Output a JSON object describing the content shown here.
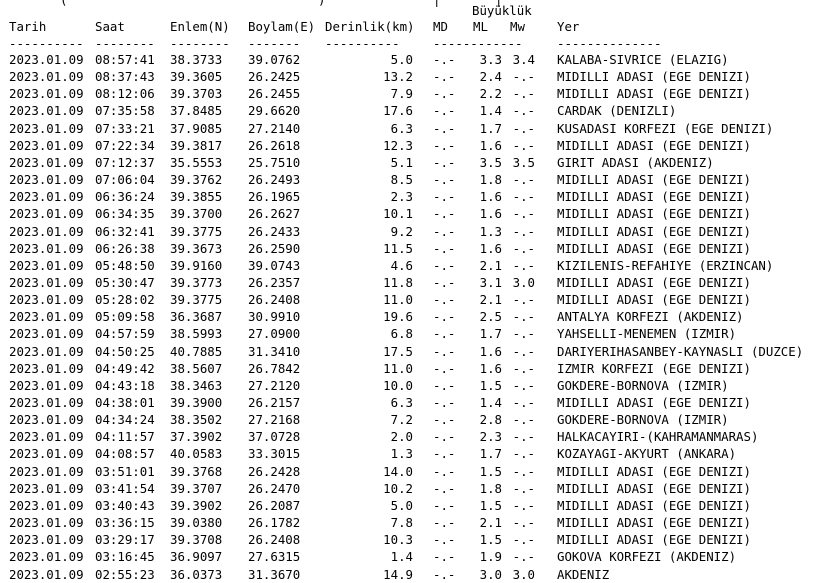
{
  "partial_top": {
    "left": "(",
    "mid": ")",
    "right": "|"
  },
  "magnitude_title": "Büyüklük",
  "headers": {
    "date": "Tarih",
    "time": "Saat",
    "lat": "Enlem(N)",
    "lon": "Boylam(E)",
    "depth": "Derinlik(km)",
    "md": "MD",
    "ml": "ML",
    "mw": "Mw",
    "location": "Yer"
  },
  "dashes": {
    "date": "----------",
    "time": "--------",
    "lat": "--------",
    "lon": "-------",
    "depth": "----------",
    "mag": "------------",
    "location": "--------------"
  },
  "rows": [
    {
      "date": "2023.01.09",
      "time": "08:57:41",
      "lat": "38.3733",
      "lon": "39.0762",
      "depth": "5.0",
      "md": "-.-",
      "ml": "3.3",
      "mw": "3.4",
      "location": "KALABA-SIVRICE (ELAZIG)"
    },
    {
      "date": "2023.01.09",
      "time": "08:37:43",
      "lat": "39.3605",
      "lon": "26.2425",
      "depth": "13.2",
      "md": "-.-",
      "ml": "2.4",
      "mw": "-.-",
      "location": "MIDILLI ADASI (EGE DENIZI)"
    },
    {
      "date": "2023.01.09",
      "time": "08:12:06",
      "lat": "39.3703",
      "lon": "26.2455",
      "depth": "7.9",
      "md": "-.-",
      "ml": "2.2",
      "mw": "-.-",
      "location": "MIDILLI ADASI (EGE DENIZI)"
    },
    {
      "date": "2023.01.09",
      "time": "07:35:58",
      "lat": "37.8485",
      "lon": "29.6620",
      "depth": "17.6",
      "md": "-.-",
      "ml": "1.4",
      "mw": "-.-",
      "location": "CARDAK (DENIZLI)"
    },
    {
      "date": "2023.01.09",
      "time": "07:33:21",
      "lat": "37.9085",
      "lon": "27.2140",
      "depth": "6.3",
      "md": "-.-",
      "ml": "1.7",
      "mw": "-.-",
      "location": "KUSADASI KORFEZI (EGE DENIZI)"
    },
    {
      "date": "2023.01.09",
      "time": "07:22:34",
      "lat": "39.3817",
      "lon": "26.2618",
      "depth": "12.3",
      "md": "-.-",
      "ml": "1.6",
      "mw": "-.-",
      "location": "MIDILLI ADASI (EGE DENIZI)"
    },
    {
      "date": "2023.01.09",
      "time": "07:12:37",
      "lat": "35.5553",
      "lon": "25.7510",
      "depth": "5.1",
      "md": "-.-",
      "ml": "3.5",
      "mw": "3.5",
      "location": "GIRIT ADASI (AKDENIZ)"
    },
    {
      "date": "2023.01.09",
      "time": "07:06:04",
      "lat": "39.3762",
      "lon": "26.2493",
      "depth": "8.5",
      "md": "-.-",
      "ml": "1.8",
      "mw": "-.-",
      "location": "MIDILLI ADASI (EGE DENIZI)"
    },
    {
      "date": "2023.01.09",
      "time": "06:36:24",
      "lat": "39.3855",
      "lon": "26.1965",
      "depth": "2.3",
      "md": "-.-",
      "ml": "1.6",
      "mw": "-.-",
      "location": "MIDILLI ADASI (EGE DENIZI)"
    },
    {
      "date": "2023.01.09",
      "time": "06:34:35",
      "lat": "39.3700",
      "lon": "26.2627",
      "depth": "10.1",
      "md": "-.-",
      "ml": "1.6",
      "mw": "-.-",
      "location": "MIDILLI ADASI (EGE DENIZI)"
    },
    {
      "date": "2023.01.09",
      "time": "06:32:41",
      "lat": "39.3775",
      "lon": "26.2433",
      "depth": "9.2",
      "md": "-.-",
      "ml": "1.3",
      "mw": "-.-",
      "location": "MIDILLI ADASI (EGE DENIZI)"
    },
    {
      "date": "2023.01.09",
      "time": "06:26:38",
      "lat": "39.3673",
      "lon": "26.2590",
      "depth": "11.5",
      "md": "-.-",
      "ml": "1.6",
      "mw": "-.-",
      "location": "MIDILLI ADASI (EGE DENIZI)"
    },
    {
      "date": "2023.01.09",
      "time": "05:48:50",
      "lat": "39.9160",
      "lon": "39.0743",
      "depth": "4.6",
      "md": "-.-",
      "ml": "2.1",
      "mw": "-.-",
      "location": "KIZILENIS-REFAHIYE (ERZINCAN)"
    },
    {
      "date": "2023.01.09",
      "time": "05:30:47",
      "lat": "39.3773",
      "lon": "26.2357",
      "depth": "11.8",
      "md": "-.-",
      "ml": "3.1",
      "mw": "3.0",
      "location": "MIDILLI ADASI (EGE DENIZI)"
    },
    {
      "date": "2023.01.09",
      "time": "05:28:02",
      "lat": "39.3775",
      "lon": "26.2408",
      "depth": "11.0",
      "md": "-.-",
      "ml": "2.1",
      "mw": "-.-",
      "location": "MIDILLI ADASI (EGE DENIZI)"
    },
    {
      "date": "2023.01.09",
      "time": "05:09:58",
      "lat": "36.3687",
      "lon": "30.9910",
      "depth": "19.6",
      "md": "-.-",
      "ml": "2.5",
      "mw": "-.-",
      "location": "ANTALYA KORFEZI (AKDENIZ)"
    },
    {
      "date": "2023.01.09",
      "time": "04:57:59",
      "lat": "38.5993",
      "lon": "27.0900",
      "depth": "6.8",
      "md": "-.-",
      "ml": "1.7",
      "mw": "-.-",
      "location": "YAHSELLI-MENEMEN (IZMIR)"
    },
    {
      "date": "2023.01.09",
      "time": "04:50:25",
      "lat": "40.7885",
      "lon": "31.3410",
      "depth": "17.5",
      "md": "-.-",
      "ml": "1.6",
      "mw": "-.-",
      "location": "DARIYERIHASANBEY-KAYNASLI (DUZCE)"
    },
    {
      "date": "2023.01.09",
      "time": "04:49:42",
      "lat": "38.5607",
      "lon": "26.7842",
      "depth": "11.0",
      "md": "-.-",
      "ml": "1.6",
      "mw": "-.-",
      "location": "IZMIR KORFEZI (EGE DENIZI)"
    },
    {
      "date": "2023.01.09",
      "time": "04:43:18",
      "lat": "38.3463",
      "lon": "27.2120",
      "depth": "10.0",
      "md": "-.-",
      "ml": "1.5",
      "mw": "-.-",
      "location": "GOKDERE-BORNOVA (IZMIR)"
    },
    {
      "date": "2023.01.09",
      "time": "04:38:01",
      "lat": "39.3900",
      "lon": "26.2157",
      "depth": "6.3",
      "md": "-.-",
      "ml": "1.4",
      "mw": "-.-",
      "location": "MIDILLI ADASI (EGE DENIZI)"
    },
    {
      "date": "2023.01.09",
      "time": "04:34:24",
      "lat": "38.3502",
      "lon": "27.2168",
      "depth": "7.2",
      "md": "-.-",
      "ml": "2.8",
      "mw": "-.-",
      "location": "GOKDERE-BORNOVA (IZMIR)"
    },
    {
      "date": "2023.01.09",
      "time": "04:11:57",
      "lat": "37.3902",
      "lon": "37.0728",
      "depth": "2.0",
      "md": "-.-",
      "ml": "2.3",
      "mw": "-.-",
      "location": "HALKACAYIRI-(KAHRAMANMARAS)"
    },
    {
      "date": "2023.01.09",
      "time": "04:08:57",
      "lat": "40.0583",
      "lon": "33.3015",
      "depth": "1.3",
      "md": "-.-",
      "ml": "1.7",
      "mw": "-.-",
      "location": "KOZAYAGI-AKYURT (ANKARA)"
    },
    {
      "date": "2023.01.09",
      "time": "03:51:01",
      "lat": "39.3768",
      "lon": "26.2428",
      "depth": "14.0",
      "md": "-.-",
      "ml": "1.5",
      "mw": "-.-",
      "location": "MIDILLI ADASI (EGE DENIZI)"
    },
    {
      "date": "2023.01.09",
      "time": "03:41:54",
      "lat": "39.3707",
      "lon": "26.2470",
      "depth": "10.2",
      "md": "-.-",
      "ml": "1.8",
      "mw": "-.-",
      "location": "MIDILLI ADASI (EGE DENIZI)"
    },
    {
      "date": "2023.01.09",
      "time": "03:40:43",
      "lat": "39.3902",
      "lon": "26.2087",
      "depth": "5.0",
      "md": "-.-",
      "ml": "1.5",
      "mw": "-.-",
      "location": "MIDILLI ADASI (EGE DENIZI)"
    },
    {
      "date": "2023.01.09",
      "time": "03:36:15",
      "lat": "39.0380",
      "lon": "26.1782",
      "depth": "7.8",
      "md": "-.-",
      "ml": "2.1",
      "mw": "-.-",
      "location": "MIDILLI ADASI (EGE DENIZI)"
    },
    {
      "date": "2023.01.09",
      "time": "03:29:17",
      "lat": "39.3708",
      "lon": "26.2408",
      "depth": "10.3",
      "md": "-.-",
      "ml": "1.5",
      "mw": "-.-",
      "location": "MIDILLI ADASI (EGE DENIZI)"
    },
    {
      "date": "2023.01.09",
      "time": "03:16:45",
      "lat": "36.9097",
      "lon": "27.6315",
      "depth": "1.4",
      "md": "-.-",
      "ml": "1.9",
      "mw": "-.-",
      "location": "GOKOVA KORFEZI (AKDENIZ)"
    },
    {
      "date": "2023.01.09",
      "time": "02:55:23",
      "lat": "36.0373",
      "lon": "31.3670",
      "depth": "14.9",
      "md": "-.-",
      "ml": "3.0",
      "mw": "3.0",
      "location": "AKDENIZ"
    }
  ]
}
